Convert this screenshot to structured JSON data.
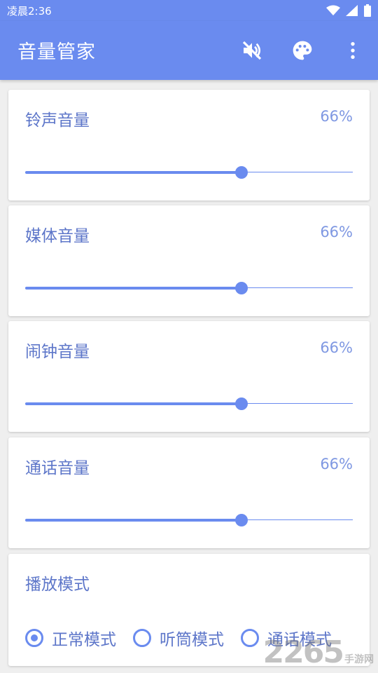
{
  "status_bar": {
    "time": "凌晨2:36",
    "icons": [
      "wifi-icon",
      "signal-icon",
      "battery-icon"
    ]
  },
  "app_bar": {
    "title": "音量管家",
    "actions": [
      "mute-icon",
      "palette-icon",
      "more-vert-icon"
    ]
  },
  "volumes": [
    {
      "label": "铃声音量",
      "value_text": "66%",
      "level": 0.66
    },
    {
      "label": "媒体音量",
      "value_text": "66%",
      "level": 0.66
    },
    {
      "label": "闹钟音量",
      "value_text": "66%",
      "level": 0.66
    },
    {
      "label": "通话音量",
      "value_text": "66%",
      "level": 0.66
    }
  ],
  "play_mode": {
    "title": "播放模式",
    "options": [
      "正常模式",
      "听筒模式",
      "通话模式"
    ],
    "selected_index": 0
  },
  "watermark": {
    "text": "2265",
    "suffix": "手游网"
  },
  "colors": {
    "primary": "#6a8bef",
    "text_accent": "#5d76c9",
    "background": "#efefef"
  }
}
